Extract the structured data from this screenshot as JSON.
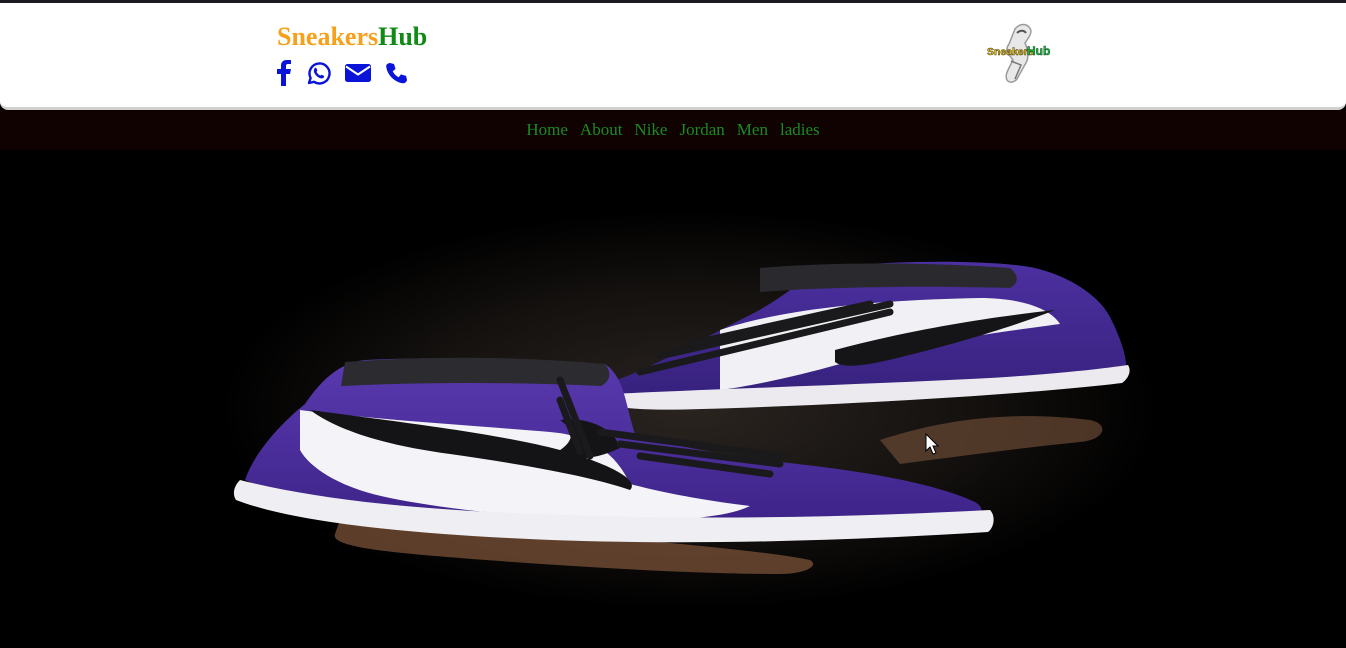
{
  "brand": {
    "part1": "Sneakers",
    "part2": "Hub",
    "color1": "#f5a11c",
    "color2": "#0f8a15"
  },
  "social": [
    {
      "icon": "facebook-icon"
    },
    {
      "icon": "whatsapp-icon"
    },
    {
      "icon": "envelope-icon"
    },
    {
      "icon": "phone-icon"
    }
  ],
  "logo": {
    "text1": "Sneakers",
    "text2": "Hub"
  },
  "nav": {
    "items": [
      "Home",
      "About",
      "Nike",
      "Jordan",
      "Men",
      "ladies"
    ],
    "color": "#1b8a22",
    "background": "#110202"
  },
  "hero": {
    "image": "purple-white-high-top-sneakers-photo"
  },
  "accent": "#0a14d9"
}
